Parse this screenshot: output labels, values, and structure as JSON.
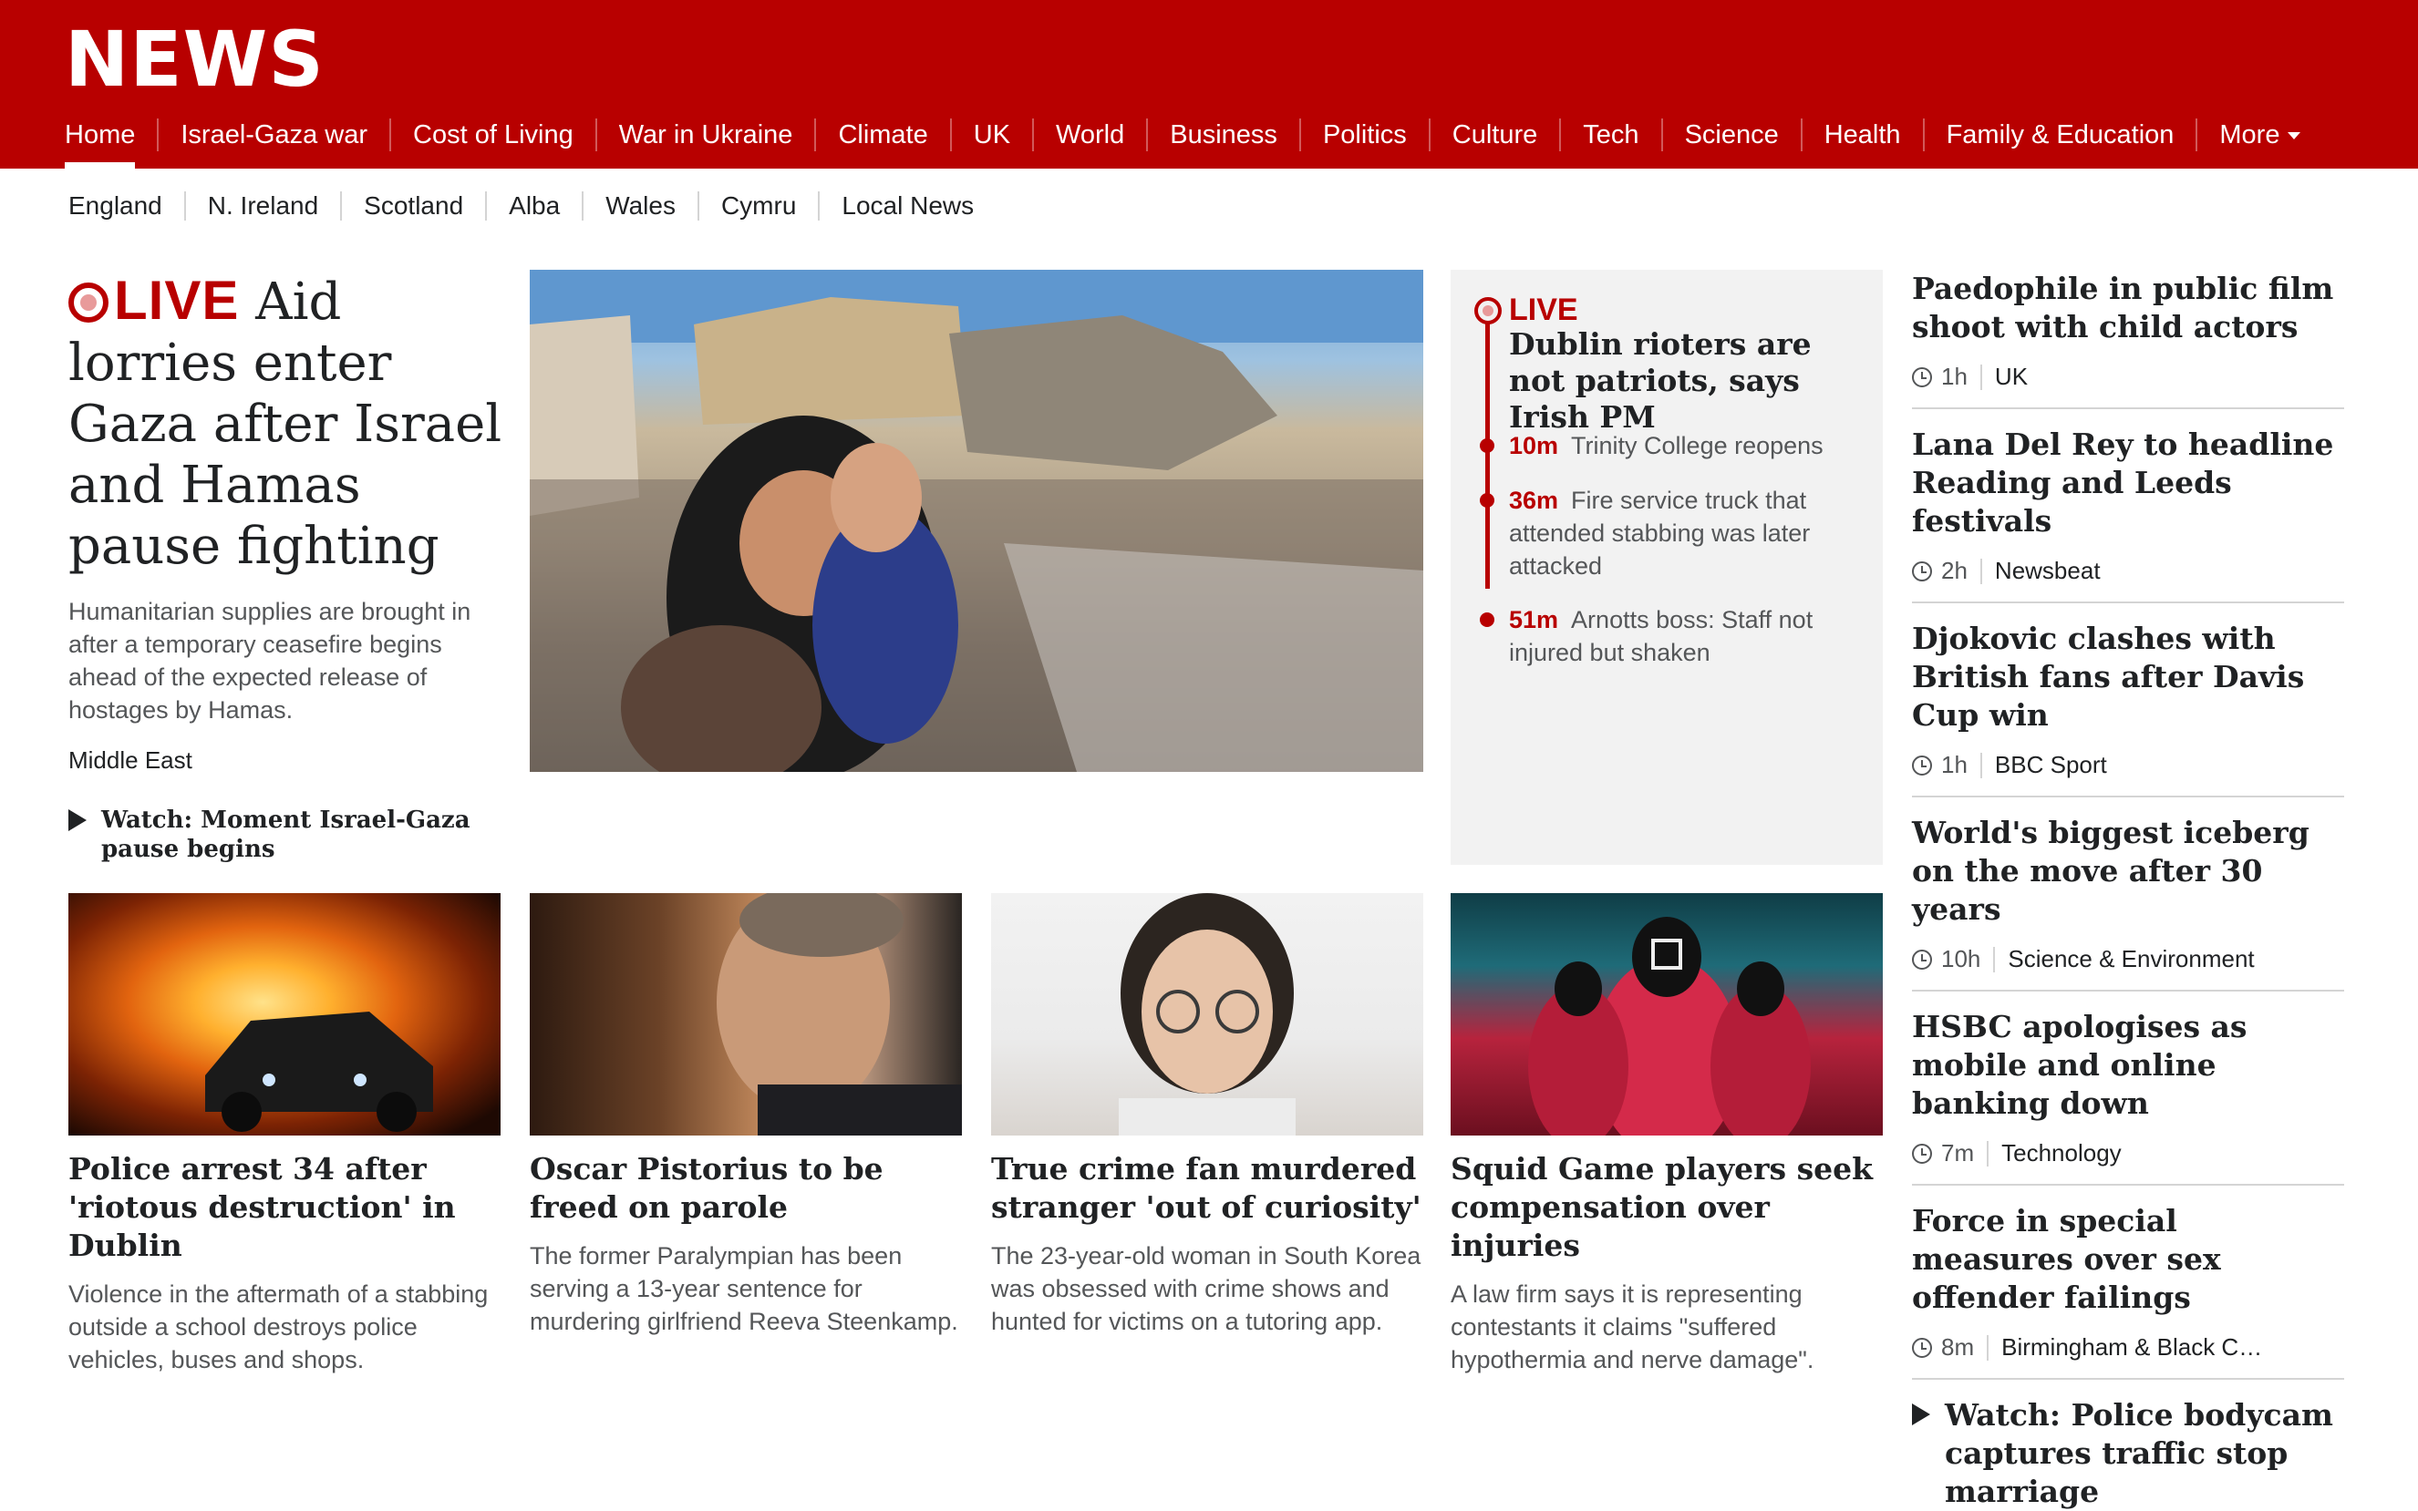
{
  "brand": "NEWS",
  "nav": {
    "items": [
      {
        "label": "Home",
        "active": true
      },
      {
        "label": "Israel-Gaza war"
      },
      {
        "label": "Cost of Living"
      },
      {
        "label": "War in Ukraine"
      },
      {
        "label": "Climate"
      },
      {
        "label": "UK"
      },
      {
        "label": "World"
      },
      {
        "label": "Business"
      },
      {
        "label": "Politics"
      },
      {
        "label": "Culture"
      },
      {
        "label": "Tech"
      },
      {
        "label": "Science"
      },
      {
        "label": "Health"
      },
      {
        "label": "Family & Education"
      }
    ],
    "more_label": "More"
  },
  "subnav": [
    "England",
    "N. Ireland",
    "Scotland",
    "Alba",
    "Wales",
    "Cymru",
    "Local News"
  ],
  "lead": {
    "live_label": "LIVE",
    "headline": "Aid lorries enter Gaza after Israel and Hamas pause fighting",
    "summary": "Humanitarian supplies are brought in after a temporary ceasefire begins ahead of the expected release of hostages by Hamas.",
    "tag": "Middle East",
    "watch": "Watch: Moment Israel-Gaza pause begins"
  },
  "live_panel": {
    "live_label": "LIVE",
    "title": "Dublin rioters are not patriots, says Irish PM",
    "entries": [
      {
        "time": "10m",
        "text": "Trinity College reopens"
      },
      {
        "time": "36m",
        "text": "Fire service truck that attended stabbing was later attacked"
      },
      {
        "time": "51m",
        "text": "Arnotts boss: Staff not injured but shaken"
      }
    ]
  },
  "right_list": [
    {
      "title": "Paedophile in public film shoot with child actors",
      "time": "1h",
      "section": "UK"
    },
    {
      "title": "Lana Del Rey to headline Reading and Leeds festivals",
      "time": "2h",
      "section": "Newsbeat"
    },
    {
      "title": "Djokovic clashes with British fans after Davis Cup win",
      "time": "1h",
      "section": "BBC Sport"
    },
    {
      "title": "World's biggest iceberg on the move after 30 years",
      "time": "10h",
      "section": "Science & Environment"
    },
    {
      "title": "HSBC apologises as mobile and online banking down",
      "time": "7m",
      "section": "Technology"
    },
    {
      "title": "Force in special measures over sex offender failings",
      "time": "8m",
      "section": "Birmingham & Black C…"
    }
  ],
  "right_watch": "Watch: Police bodycam captures traffic stop marriage",
  "cards": [
    {
      "title": "Police arrest 34 after 'riotous destruction' in Dublin",
      "summary": "Violence in the aftermath of a stabbing outside a school destroys police vehicles, buses and shops."
    },
    {
      "title": "Oscar Pistorius to be freed on parole",
      "summary": "The former Paralympian has been serving a 13-year sentence for murdering girlfriend Reeva Steenkamp."
    },
    {
      "title": "True crime fan murdered stranger 'out of curiosity'",
      "summary": "The 23-year-old woman in South Korea was obsessed with crime shows and hunted for victims on a tutoring app."
    },
    {
      "title": "Squid Game players seek compensation over injuries",
      "summary": "A law firm says it is representing contestants it claims \"suffered hypothermia and nerve damage\"."
    }
  ],
  "icons": {
    "live": "live-indicator-icon",
    "play": "play-icon",
    "clock": "clock-icon",
    "caret": "chevron-down-icon"
  },
  "colors": {
    "brand_red": "#b80000",
    "text": "#202224",
    "muted": "#545658",
    "panel": "#f2f2f2"
  }
}
